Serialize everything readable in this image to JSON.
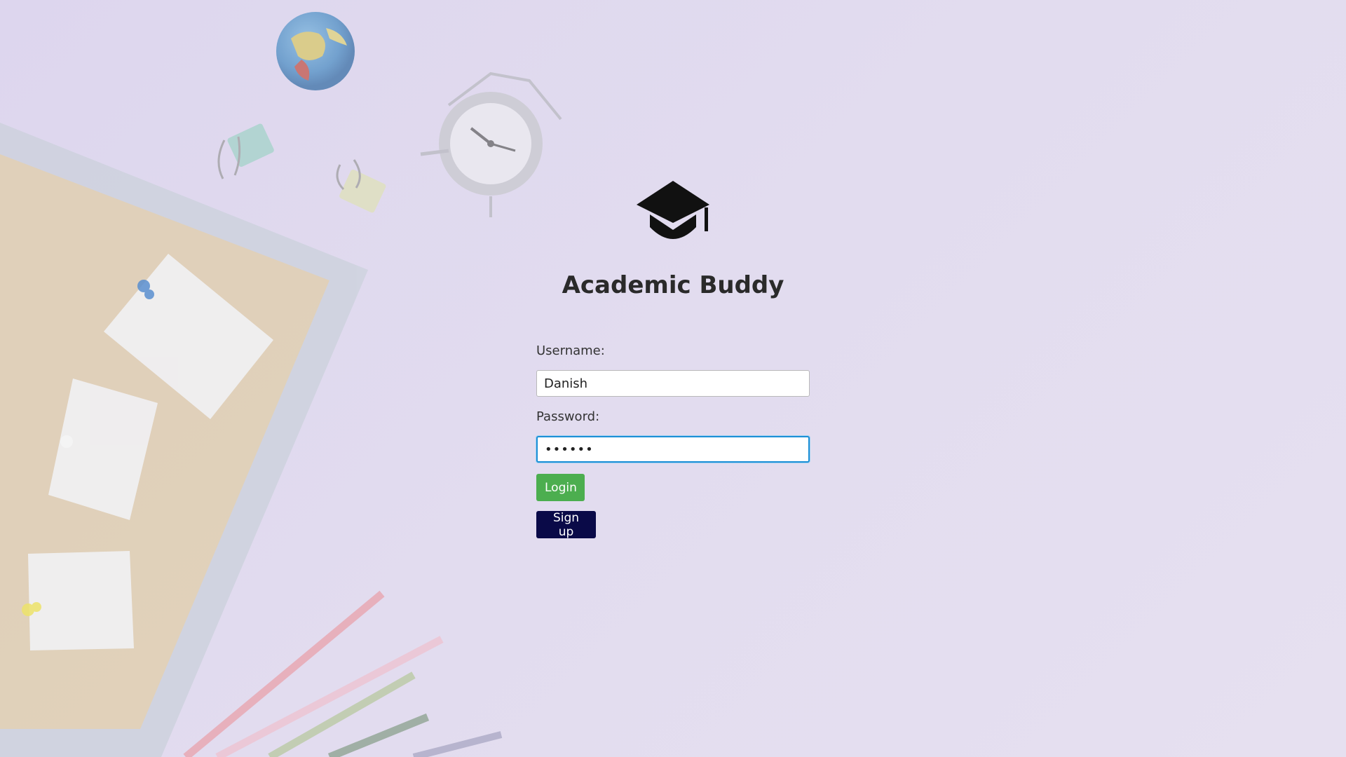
{
  "app": {
    "title": "Academic Buddy",
    "logo_icon": "graduation-cap-icon"
  },
  "form": {
    "username_label": "Username:",
    "username_value": "Danish",
    "password_label": "Password:",
    "password_value": "••••••",
    "login_label": "Login",
    "signup_label": "Sign up"
  },
  "colors": {
    "background": "#e2dcef",
    "login_button": "#4cae4f",
    "signup_button": "#0a0a48",
    "focus_border": "#1d8fd6"
  },
  "background_icons": [
    "globe-icon",
    "binder-clip-icon",
    "alarm-clock-icon",
    "corkboard-icon",
    "sticky-note-icon",
    "push-pin-icon",
    "pencil-icon"
  ]
}
